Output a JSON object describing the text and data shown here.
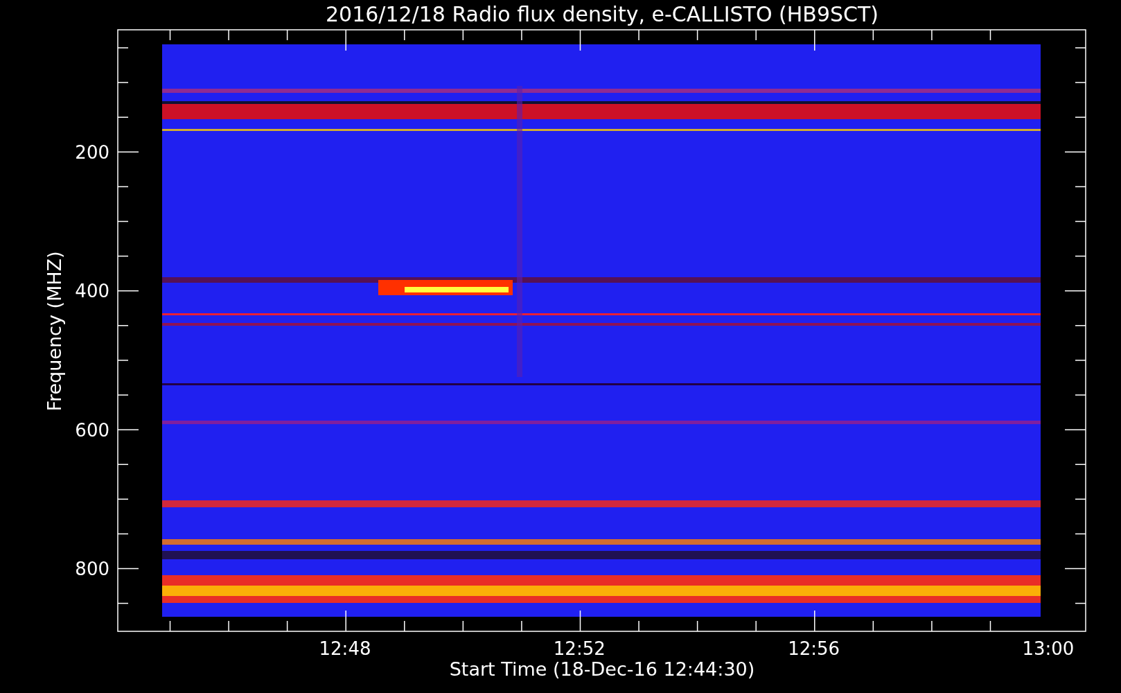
{
  "title": "2016/12/18  Radio flux density, e-CALLISTO (HB9SCT)",
  "y_axis": {
    "label": "Frequency (MHZ)",
    "ticks": [
      "200",
      "400",
      "600",
      "800"
    ]
  },
  "x_axis": {
    "label": "Start Time (18-Dec-16 12:44:30)",
    "ticks": [
      "12:48",
      "12:52",
      "12:56",
      "13:00"
    ]
  }
}
